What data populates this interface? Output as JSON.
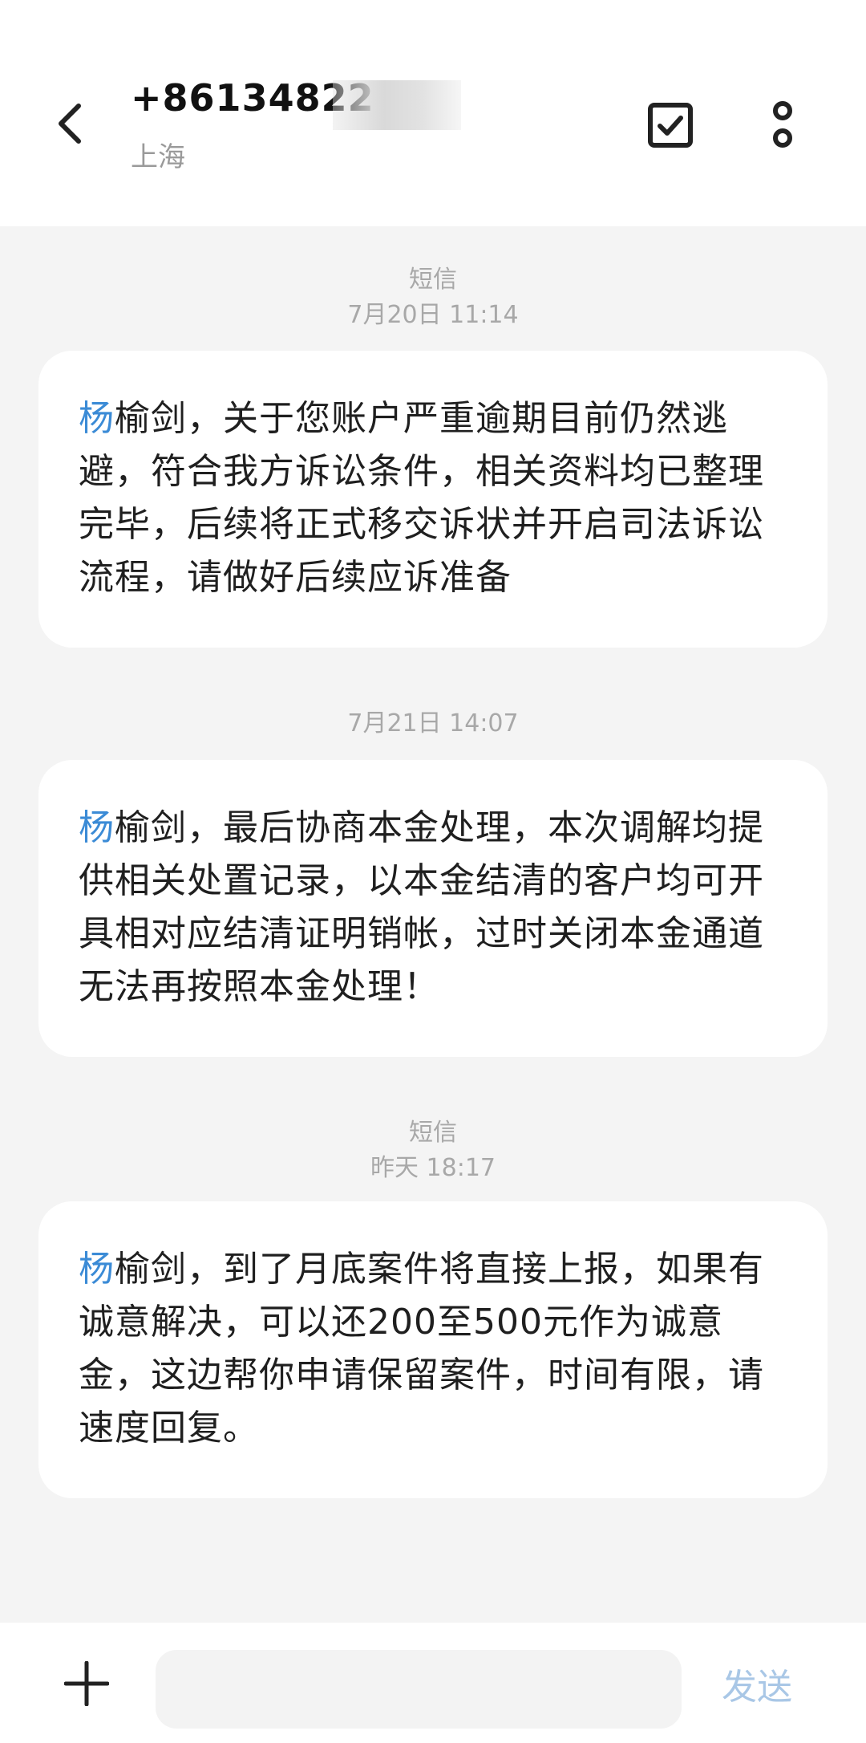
{
  "header": {
    "back_icon": "back-chevron-icon",
    "number": "+86134822",
    "location": "上海",
    "select_icon": "checkbox-icon",
    "more_icon": "more-vertical-icon"
  },
  "messages": [
    {
      "label": "短信",
      "time": "7月20日 11:14",
      "highlight": "杨",
      "text": "榆剑，关于您账户严重逾期目前仍然逃避，符合我方诉讼条件，相关资料均已整理完毕，后续将正式移交诉状并开启司法诉讼流程，请做好后续应诉准备"
    },
    {
      "label": "",
      "time": "7月21日 14:07",
      "highlight": "杨",
      "text": "榆剑，最后协商本金处理，本次调解均提供相关处置记录，以本金结清的客户均可开具相对应结清证明销帐，过时关闭本金通道无法再按照本金处理！"
    },
    {
      "label": "短信",
      "time": "昨天 18:17",
      "highlight": "杨",
      "text": "榆剑，到了月底案件将直接上报，如果有诚意解决，可以还200至500元作为诚意金，这边帮你申请保留案件，时间有限，请速度回复。"
    }
  ],
  "composer": {
    "add_icon": "plus-icon",
    "input_value": "",
    "input_placeholder": "",
    "send_label": "发送"
  },
  "colors": {
    "highlight": "#3b8bd6",
    "send_disabled": "#a9c7e6",
    "thread_bg": "#f4f4f4"
  }
}
